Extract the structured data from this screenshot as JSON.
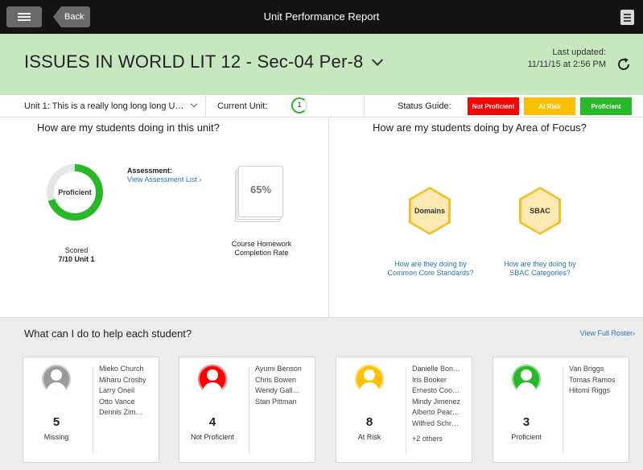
{
  "topbar": {
    "back_label": "Back",
    "title": "Unit Performance Report"
  },
  "class_header": {
    "class_name": "ISSUES IN WORLD LIT 12 - Sec-04 Per-8",
    "last_updated_label": "Last updated:",
    "last_updated_value": "11/11/15 at 2:56 PM"
  },
  "unit_bar": {
    "unit_selected": "Unit 1: This is a really long long long U…",
    "current_unit_label": "Current  Unit:",
    "current_unit_value": "1",
    "status_guide_label": "Status Guide:",
    "status_guide": [
      {
        "label": "Not Proficient",
        "color": "#ff0000"
      },
      {
        "label": "At Risk",
        "color": "#ffc000"
      },
      {
        "label": "Proficient",
        "color": "#28b928"
      }
    ]
  },
  "unit_panel": {
    "title": "How are my students doing in this unit?",
    "donut_label": "Proficient",
    "donut_fraction": 0.7,
    "scored_label": "Scored",
    "scored_value": "7/10 Unit 1",
    "assessment_heading": "Assessment:",
    "assessment_link": "View Assessment List ›",
    "homework_rate": "65%",
    "homework_label": "Course Homework Completion Rate"
  },
  "focus_panel": {
    "title": "How are my students doing by Area of Focus?",
    "areas": [
      {
        "label": "Domains",
        "link": "How are they doing by Common Core Standards?"
      },
      {
        "label": "SBAC",
        "link": "How are they doing by SBAC Categories?"
      }
    ]
  },
  "help_section": {
    "title": "What can I do to help each student?",
    "roster_link": "View Full Roster›",
    "cards": [
      {
        "count": "5",
        "category": "Missing",
        "color": "#9a9a9a",
        "names": [
          "Mieko Church",
          "Miharu Crosby",
          "Larry Oneil",
          "Otto Vance",
          "Dennis Zim…"
        ],
        "more": ""
      },
      {
        "count": "4",
        "category": "Not Proficient",
        "color": "#ff0000",
        "names": [
          "Ayumi Benson",
          "Chris Bowen",
          "Wendy Gall…",
          "Stan Pittman"
        ],
        "more": ""
      },
      {
        "count": "8",
        "category": "At Risk",
        "color": "#ffc000",
        "names": [
          "Danielle Bon…",
          "Iris Booker",
          "Ernesto Coo…",
          "Mindy Jimenez",
          "Alberto Pear…",
          "Wilfred Schr…"
        ],
        "more": "+2 others"
      },
      {
        "count": "3",
        "category": "Proficient",
        "color": "#28b928",
        "names": [
          "Van Briggs",
          "Tomas Ramos",
          "Hitomi Riggs"
        ],
        "more": ""
      }
    ]
  }
}
